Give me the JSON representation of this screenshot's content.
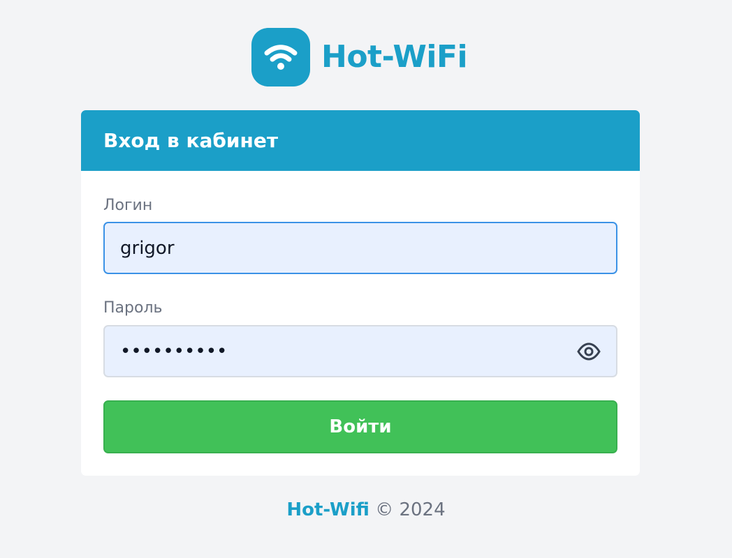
{
  "brand": {
    "name": "Hot-WiFi",
    "logo_icon": "wifi-icon",
    "color": "#1b9fc8"
  },
  "login_card": {
    "title": "Вход в кабинет",
    "header_color": "#1b9fc8",
    "login_label": "Логин",
    "login_value": "grigor",
    "password_label": "Пароль",
    "password_value": "••••••••••",
    "password_toggle_icon": "eye-icon",
    "submit_label": "Войти",
    "submit_color": "#41c158"
  },
  "footer": {
    "brand": "Hot-Wifi",
    "copyright": "© 2024"
  }
}
